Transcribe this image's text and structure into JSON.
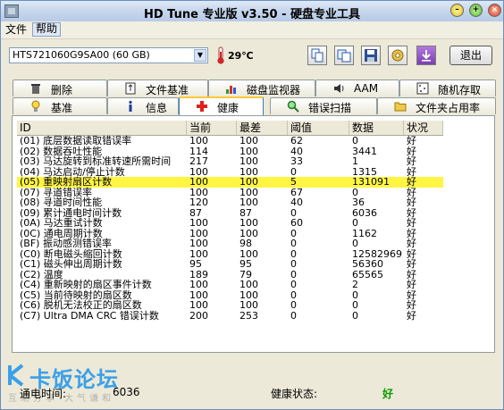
{
  "window": {
    "title": "HD Tune 专业版 v3.50 - 硬盘专业工具"
  },
  "menu": {
    "file": "文件",
    "help": "帮助"
  },
  "toolbar": {
    "drive": "HTS721060G9SA00 (60 GB)",
    "temperature": "29℃",
    "exit_label": "退出"
  },
  "tabs_row1": [
    {
      "label": "删除",
      "icon": "trash-icon"
    },
    {
      "label": "文件基准",
      "icon": "file-benchmark-icon"
    },
    {
      "label": "磁盘监视器",
      "icon": "disk-monitor-icon"
    },
    {
      "label": "AAM",
      "icon": "speaker-icon"
    },
    {
      "label": "随机存取",
      "icon": "random-access-icon"
    }
  ],
  "tabs_row2": [
    {
      "label": "基准",
      "icon": "benchmark-icon"
    },
    {
      "label": "信息",
      "icon": "info-icon"
    },
    {
      "label": "健康",
      "icon": "health-icon"
    },
    {
      "label": "错误扫描",
      "icon": "magnifier-icon"
    },
    {
      "label": "文件夹占用率",
      "icon": "folder-icon"
    }
  ],
  "table": {
    "headers": [
      "ID",
      "当前",
      "最差",
      "阈值",
      "数据",
      "状况"
    ],
    "rows": [
      [
        "(01) 底层数据读取错误率",
        "100",
        "100",
        "62",
        "0",
        "好"
      ],
      [
        "(02) 数据吞吐性能",
        "114",
        "100",
        "40",
        "3441",
        "好"
      ],
      [
        "(03) 马达旋转到标准转速所需时间",
        "217",
        "100",
        "33",
        "1",
        "好"
      ],
      [
        "(04) 马达启动/停止计数",
        "100",
        "100",
        "0",
        "1315",
        "好"
      ],
      [
        "(05) 重映射扇区计数",
        "100",
        "100",
        "5",
        "131091",
        "好"
      ],
      [
        "(07) 寻道错误率",
        "100",
        "100",
        "67",
        "0",
        "好"
      ],
      [
        "(08) 寻道时间性能",
        "120",
        "100",
        "40",
        "36",
        "好"
      ],
      [
        "(09) 累计通电时间计数",
        "87",
        "87",
        "0",
        "6036",
        "好"
      ],
      [
        "(0A) 马达重试计数",
        "100",
        "100",
        "60",
        "0",
        "好"
      ],
      [
        "(0C) 通电周期计数",
        "100",
        "100",
        "0",
        "1162",
        "好"
      ],
      [
        "(BF) 振动感测错误率",
        "100",
        "98",
        "0",
        "0",
        "好"
      ],
      [
        "(C0) 断电磁头缩回计数",
        "100",
        "100",
        "0",
        "12582969",
        "好"
      ],
      [
        "(C1) 磁头伸出周期计数",
        "95",
        "95",
        "0",
        "56360",
        "好"
      ],
      [
        "(C2) 温度",
        "189",
        "79",
        "0",
        "65565",
        "好"
      ],
      [
        "(C4) 重新映射的扇区事件计数",
        "100",
        "100",
        "0",
        "2",
        "好"
      ],
      [
        "(C5) 当前待映射的扇区数",
        "100",
        "100",
        "0",
        "0",
        "好"
      ],
      [
        "(C6) 脱机无法校正的扇区数",
        "100",
        "100",
        "0",
        "0",
        "好"
      ],
      [
        "(C7) Ultra DMA CRC 错误计数",
        "200",
        "253",
        "0",
        "0",
        "好"
      ]
    ],
    "highlight_row": 4
  },
  "footer": {
    "power_on_label": "通电时间:",
    "power_on_value": "6036",
    "health_label": "健康状态:",
    "health_value": "好",
    "watermark": "卡饭论坛",
    "watermark_sub": "互助分享 大气谦和"
  },
  "colors": {
    "highlight": "#fff542",
    "good": "#0a9a00",
    "active_tab_accent": "#ffc83c"
  }
}
